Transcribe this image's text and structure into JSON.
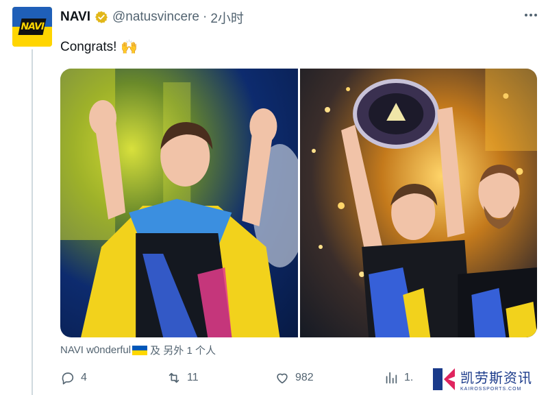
{
  "author": {
    "name": "NAVI",
    "handle": "@natusvincere",
    "separator": "·",
    "time": "2小时",
    "avatar_text": "NAVI"
  },
  "tweet": {
    "text": "Congrats!",
    "emoji": "🙌"
  },
  "media": {
    "count": 2
  },
  "tagged": {
    "user": "NAVI w0nderful",
    "suffix": "及 另外 1 个人"
  },
  "actions": {
    "replies": "4",
    "retweets": "11",
    "likes": "982",
    "views": "1."
  },
  "watermark": {
    "cn": "凯劳斯资讯",
    "en": "KAIROSSPORTS.COM"
  },
  "colors": {
    "verified": "#e2b719",
    "muted": "#536471",
    "text": "#0f1419",
    "ukraine_blue": "#0057b7",
    "ukraine_yellow": "#ffd700"
  }
}
